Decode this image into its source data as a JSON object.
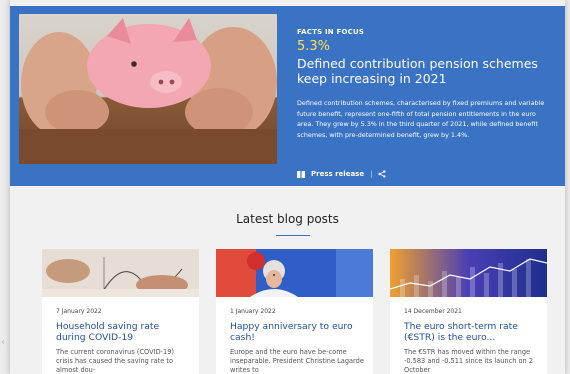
{
  "hero": {
    "eyebrow": "FACTS IN FOCUS",
    "stat": "5.3%",
    "headline": "Defined contribution pension schemes keep increasing in 2021",
    "summary": "Defined contribution schemes, characterised by fixed premiums and variable future benefit, represent one-fifth of total pension entitlements in the euro area. They grew by 5.3% in the third quarter of 2021, while defined benefit schemes, with pre-determined benefit, grew by 1.4%.",
    "press_label": "Press release",
    "colors": {
      "background": "#3a72c4",
      "stat": "#ffe14d"
    }
  },
  "blog": {
    "title": "Latest blog posts",
    "posts": [
      {
        "date": "7 January 2022",
        "title": "Household saving rate during COVID-19",
        "excerpt": "The current coronavirus (COVID-19) crisis has caused the saving rate to almost dou-"
      },
      {
        "date": "1 January 2022",
        "title": "Happy anniversary to euro cash!",
        "excerpt": "Europe and the euro have be-come inseparable. President Christine Lagarde writes to"
      },
      {
        "date": "14 December 2021",
        "title": "The euro short-term rate (€STR) is the euro...",
        "excerpt": "The €STR has moved within the range -0.583 and -0.511 since its launch on 2 October"
      }
    ]
  }
}
